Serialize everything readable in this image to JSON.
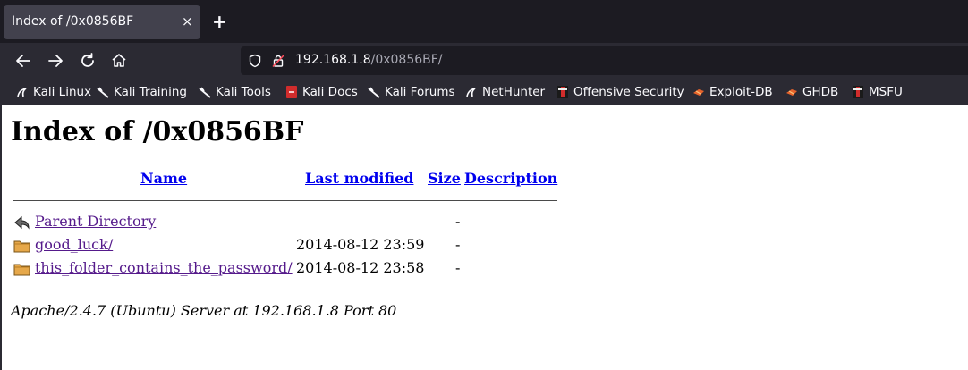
{
  "browser": {
    "tab": {
      "title": "Index of /0x0856BF",
      "close": "×"
    },
    "new_tab": "+",
    "url": {
      "host": "192.168.1.8",
      "path": "/0x0856BF/"
    },
    "bookmarks": [
      {
        "label": "Kali Linux",
        "icon": "kali-dragon-icon"
      },
      {
        "label": "Kali Training",
        "icon": "kali-dragon-icon"
      },
      {
        "label": "Kali Tools",
        "icon": "kali-dragon-icon"
      },
      {
        "label": "Kali Docs",
        "icon": "docs-icon"
      },
      {
        "label": "Kali Forums",
        "icon": "kali-dragon-icon"
      },
      {
        "label": "NetHunter",
        "icon": "nethunter-icon"
      },
      {
        "label": "Offensive Security",
        "icon": "offsec-icon"
      },
      {
        "label": "Exploit-DB",
        "icon": "exploitdb-icon"
      },
      {
        "label": "GHDB",
        "icon": "exploitdb-icon"
      },
      {
        "label": "MSFU",
        "icon": "offsec-icon"
      }
    ]
  },
  "page": {
    "title": "Index of /0x0856BF",
    "columns": {
      "name": "Name",
      "last_modified": "Last modified",
      "size": "Size",
      "description": "Description"
    },
    "rows": [
      {
        "name": "Parent Directory",
        "date": "",
        "size": "-",
        "icon": "back-arrow-icon"
      },
      {
        "name": "good_luck/",
        "date": "2014-08-12 23:59",
        "size": "-",
        "icon": "folder-icon"
      },
      {
        "name": "this_folder_contains_the_password/",
        "date": "2014-08-12 23:58",
        "size": "-",
        "icon": "folder-icon"
      }
    ],
    "footer": "Apache/2.4.7 (Ubuntu) Server at 192.168.1.8 Port 80"
  }
}
